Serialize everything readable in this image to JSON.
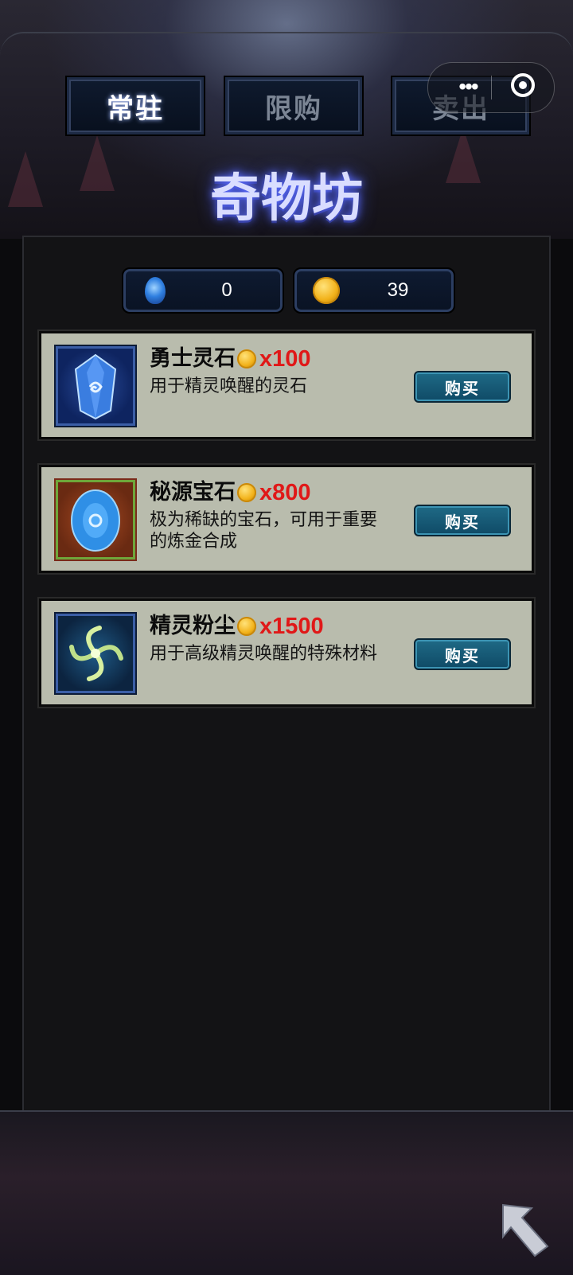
{
  "tabs": [
    {
      "label": "常驻",
      "active": true
    },
    {
      "label": "限购",
      "active": false
    },
    {
      "label": "卖出",
      "active": false
    }
  ],
  "title": "奇物坊",
  "currency": {
    "gems": {
      "icon": "blue-gem-icon",
      "value": "0"
    },
    "coins": {
      "icon": "gold-coin-icon",
      "value": "39"
    }
  },
  "items": [
    {
      "name": "勇士灵石",
      "price": "x100",
      "desc": "用于精灵唤醒的灵石",
      "buy_label": "购买",
      "icon": "spirit-stone-icon"
    },
    {
      "name": "秘源宝石",
      "price": "x800",
      "desc": "极为稀缺的宝石，可用于重要的炼金合成",
      "buy_label": "购买",
      "icon": "source-gem-icon"
    },
    {
      "name": "精灵粉尘",
      "price": "x1500",
      "desc": "用于高级精灵唤醒的特殊材料",
      "buy_label": "购买",
      "icon": "spirit-dust-icon"
    }
  ],
  "colors": {
    "price": "#e01818",
    "card": "#b9bcad",
    "accent": "#1f6a86"
  }
}
